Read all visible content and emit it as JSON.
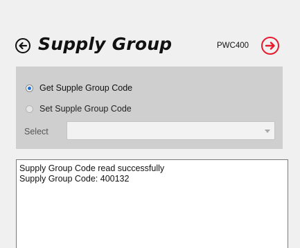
{
  "header": {
    "title": "Supply Group",
    "model": "PWC400",
    "back_icon": "arrow-left-circle-icon",
    "next_icon": "arrow-right-circle-icon",
    "next_color": "#e8192c"
  },
  "options": {
    "get_label": "Get Supple Group Code",
    "set_label": "Set  Supple Group Code",
    "selected": "get"
  },
  "select": {
    "label": "Select",
    "value": ""
  },
  "output": {
    "lines": [
      "Supply Group Code read successfully",
      "Supply Group Code: 400132"
    ]
  },
  "colors": {
    "panel": "#cfcfcf",
    "background": "#f0f0f0",
    "radio_checked": "#1f6fd0"
  }
}
